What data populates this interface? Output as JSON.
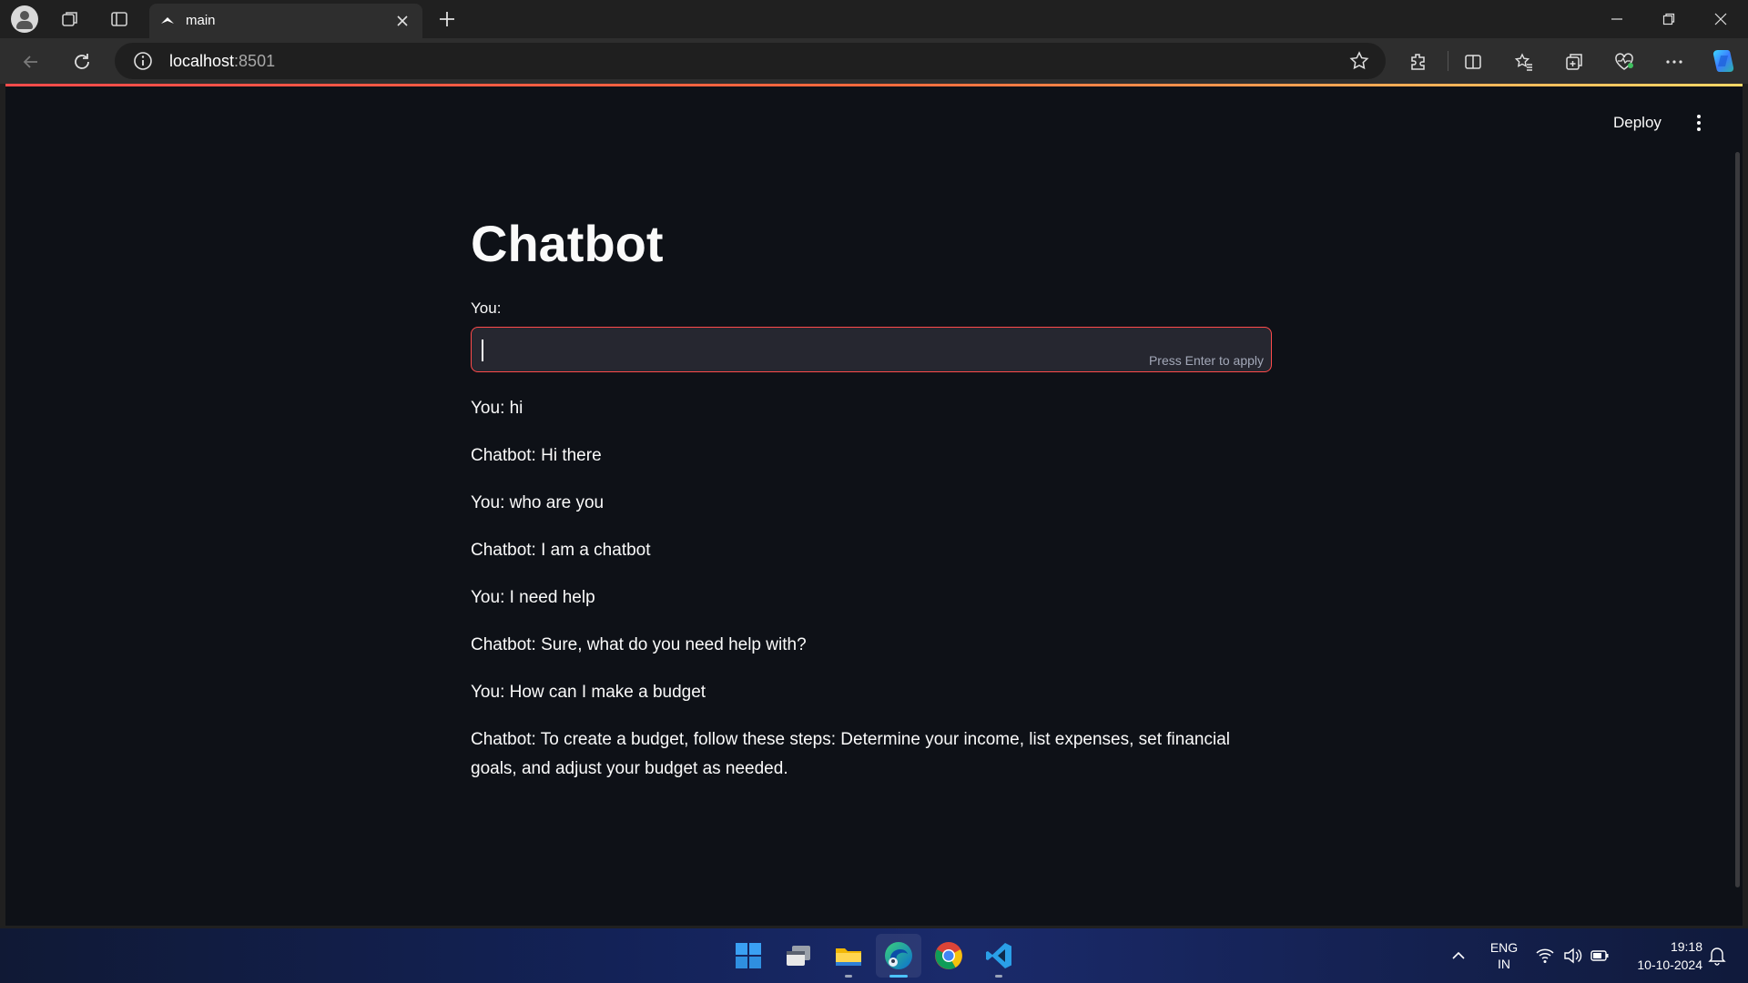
{
  "browser": {
    "tab_title": "main",
    "address_host": "localhost",
    "address_port": ":8501"
  },
  "app": {
    "deploy_label": "Deploy",
    "title": "Chatbot",
    "input_label": "You:",
    "input_value": "",
    "input_hint": "Press Enter to apply",
    "messages": [
      "You: hi",
      "Chatbot: Hi there",
      "You: who are you",
      "Chatbot: I am a chatbot",
      "You: I need help",
      "Chatbot: Sure, what do you need help with?",
      "You: How can I make a budget",
      "Chatbot: To create a budget, follow these steps: Determine your income, list expenses, set financial goals, and adjust your budget as needed."
    ]
  },
  "taskbar": {
    "icons": [
      "windows-start-icon",
      "task-view-icon",
      "file-explorer-icon",
      "edge-icon",
      "chrome-icon",
      "vscode-icon"
    ],
    "lang_top": "ENG",
    "lang_bottom": "IN",
    "time": "19:18",
    "date": "10-10-2024"
  },
  "colors": {
    "page_bg": "#0e1117",
    "accent": "#ff4b4b",
    "input_bg": "#262730",
    "text": "#fafafa"
  }
}
